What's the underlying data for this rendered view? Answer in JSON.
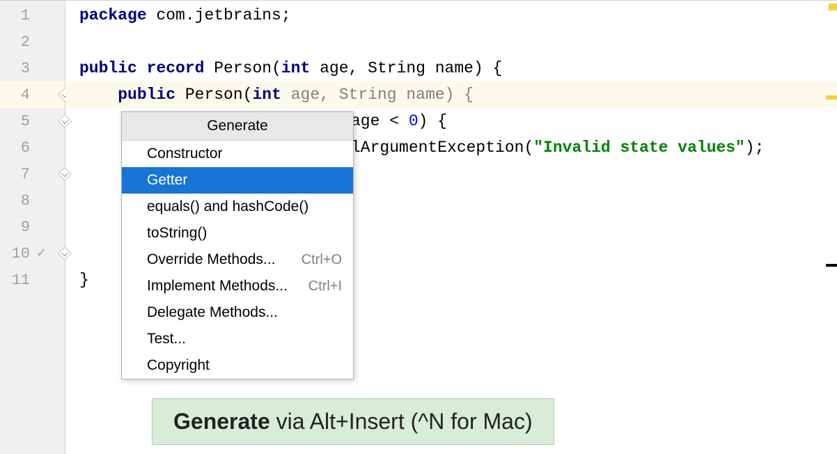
{
  "gutter": {
    "lines": [
      "1",
      "2",
      "3",
      "4",
      "5",
      "6",
      "7",
      "8",
      "9",
      "10",
      "11"
    ],
    "highlighted_line": 4,
    "checkmark_line": 10
  },
  "code": {
    "line1": {
      "package_kw": "package",
      "package_name": " com.jetbrains",
      "semi": ";"
    },
    "line3": {
      "public_kw": "public record ",
      "class_name": "Person",
      "open": "(",
      "int_kw": "int",
      "age": " age",
      "comma": ", ",
      "string_type": "String name",
      "close": ") {"
    },
    "line4": {
      "indent": "    ",
      "public_kw": "public ",
      "ctor_name": "Person",
      "open": "(",
      "int_kw": "int",
      "age": " age",
      "comma": ", ",
      "string_type": "String name",
      "close": ") {"
    },
    "line5": {
      "visible_part": "age < ",
      "zero": "0",
      "close": ") {"
    },
    "line6": {
      "visible_part": "lArgumentException(",
      "string": "\"Invalid state values\"",
      "close": ");"
    },
    "line11": {
      "brace": "}"
    }
  },
  "popup": {
    "title": "Generate",
    "items": [
      {
        "label": "Constructor",
        "shortcut": "",
        "selected": false
      },
      {
        "label": "Getter",
        "shortcut": "",
        "selected": true
      },
      {
        "label": "equals() and hashCode()",
        "shortcut": "",
        "selected": false
      },
      {
        "label": "toString()",
        "shortcut": "",
        "selected": false
      },
      {
        "label": "Override Methods...",
        "shortcut": "Ctrl+O",
        "selected": false
      },
      {
        "label": "Implement Methods...",
        "shortcut": "Ctrl+I",
        "selected": false
      },
      {
        "label": "Delegate Methods...",
        "shortcut": "",
        "selected": false
      },
      {
        "label": "Test...",
        "shortcut": "",
        "selected": false
      },
      {
        "label": "Copyright",
        "shortcut": "",
        "selected": false
      }
    ]
  },
  "hint": {
    "bold": "Generate",
    "rest": " via Alt+Insert (^N for Mac)"
  }
}
